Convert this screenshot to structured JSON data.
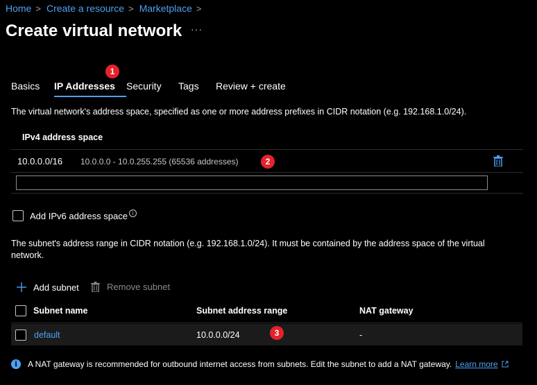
{
  "breadcrumb": {
    "items": [
      "Home",
      "Create a resource",
      "Marketplace"
    ],
    "separator": ">"
  },
  "page": {
    "title": "Create virtual network",
    "more_label": "···"
  },
  "tabs": [
    {
      "label": "Basics",
      "active": false
    },
    {
      "label": "IP Addresses",
      "active": true
    },
    {
      "label": "Security",
      "active": false
    },
    {
      "label": "Tags",
      "active": false
    },
    {
      "label": "Review + create",
      "active": false
    }
  ],
  "annotations": {
    "badge1": "1",
    "badge2": "2",
    "badge3": "3",
    "color": "#e5222c"
  },
  "address_space": {
    "description": "The virtual network's address space, specified as one or more address prefixes in CIDR notation (e.g. 192.168.1.0/24).",
    "column_header": "IPv4 address space",
    "entries": [
      {
        "prefix": "10.0.0.0/16",
        "range": "10.0.0.0 - 10.0.255.255 (65536 addresses)"
      }
    ],
    "new_entry_value": "",
    "delete_icon": "trash-icon"
  },
  "ipv6": {
    "label": "Add IPv6 address space",
    "checked": false,
    "info_icon": "info-icon"
  },
  "subnets": {
    "description": "The subnet's address range in CIDR notation (e.g. 192.168.1.0/24). It must be contained by the address space of the virtual network.",
    "add_label": "Add subnet",
    "remove_label": "Remove subnet",
    "columns": [
      "Subnet name",
      "Subnet address range",
      "NAT gateway"
    ],
    "rows": [
      {
        "name": "default",
        "range": "10.0.0.0/24",
        "nat": "-"
      }
    ]
  },
  "info_bar": {
    "text": "A NAT gateway is recommended for outbound internet access from subnets. Edit the subnet to add a NAT gateway.",
    "link_label": "Learn more",
    "icon": "info-icon",
    "external_icon": "external-link-icon"
  },
  "colors": {
    "accent": "#4ea1f3",
    "background": "#000000",
    "row_highlight": "#1b1b1b",
    "badge": "#e5222c"
  }
}
